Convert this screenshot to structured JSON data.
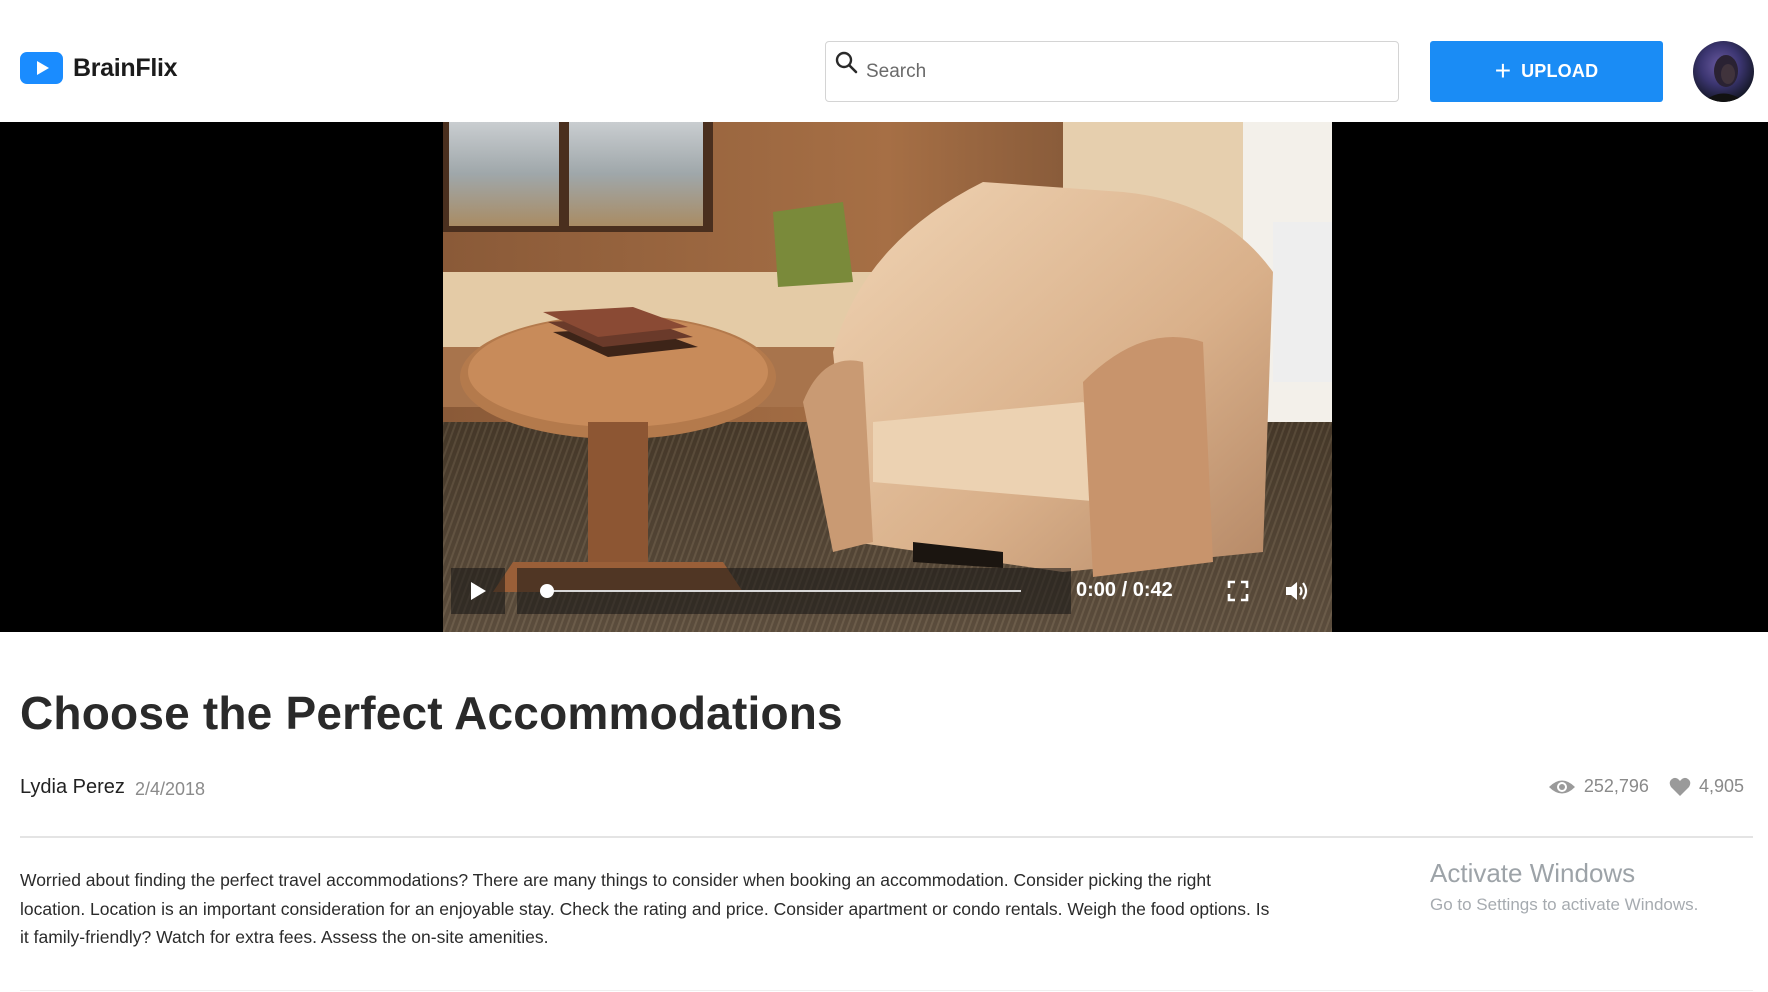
{
  "app": {
    "name": "BrainFlix",
    "logo_icon": "play-logo-icon",
    "brand_color": "#1a8cf5"
  },
  "header": {
    "search": {
      "placeholder": "Search",
      "icon": "search-icon"
    },
    "upload": {
      "label": "UPLOAD",
      "icon": "plus-icon"
    },
    "avatar": "user-avatar"
  },
  "player": {
    "time_display": "0:00 / 0:42",
    "progress_fraction": 0,
    "controls": [
      "play-icon",
      "fullscreen-icon",
      "volume-icon"
    ]
  },
  "video": {
    "title": "Choose the Perfect Accommodations",
    "channel": "Lydia Perez",
    "date": "2/4/2018",
    "views": "252,796",
    "likes": "4,905",
    "description": "Worried about finding the perfect travel accommodations? There are many things to consider when booking an accommodation. Consider picking the right location. Location is an important consideration for an enjoyable stay. Check the rating and price. Consider apartment or condo rentals. Weigh the food options. Is it family-friendly? Watch for extra fees. Assess the on-site amenities."
  },
  "os_overlay": {
    "title": "Activate Windows",
    "subtitle": "Go to Settings to activate Windows."
  }
}
